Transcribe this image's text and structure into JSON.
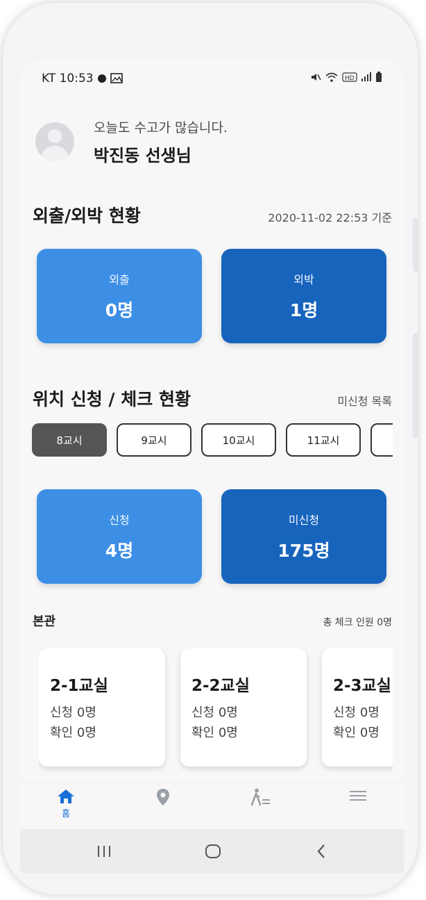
{
  "status_bar": {
    "carrier_time": "KT 10:53",
    "right_icons": [
      "mute-icon",
      "wifi-icon",
      "hd-icon",
      "signal-icon",
      "battery-icon"
    ]
  },
  "profile": {
    "greeting": "오늘도 수고가 많습니다.",
    "name": "박진동 선생님"
  },
  "outing": {
    "title": "외출/외박 현황",
    "timestamp": "2020-11-02 22:53 기준",
    "cards": [
      {
        "label": "외출",
        "value": "0명"
      },
      {
        "label": "외박",
        "value": "1명"
      }
    ]
  },
  "location": {
    "title": "위치 신청 / 체크 현황",
    "link": "미신청 목록",
    "periods": [
      "8교시",
      "9교시",
      "10교시",
      "11교시",
      ""
    ],
    "active_period": "8교시",
    "cards": [
      {
        "label": "신청",
        "value": "4명"
      },
      {
        "label": "미신청",
        "value": "175명"
      }
    ]
  },
  "building": {
    "name": "본관",
    "total": "총 체크 인원 0명",
    "rooms": [
      {
        "name": "2-1교실",
        "applied": "신청 0명",
        "checked": "확인 0명"
      },
      {
        "name": "2-2교실",
        "applied": "신청 0명",
        "checked": "확인 0명"
      },
      {
        "name": "2-3교실",
        "applied": "신청 0명",
        "checked": "확인 0명"
      }
    ]
  },
  "tabbar": {
    "home_label": "홈",
    "icons": [
      "home-icon",
      "location-pin-icon",
      "walking-person-icon",
      "menu-icon"
    ]
  },
  "colors": {
    "card_light": "#3d8fe6",
    "card_dark": "#1764bd",
    "accent": "#1a6fd6"
  }
}
